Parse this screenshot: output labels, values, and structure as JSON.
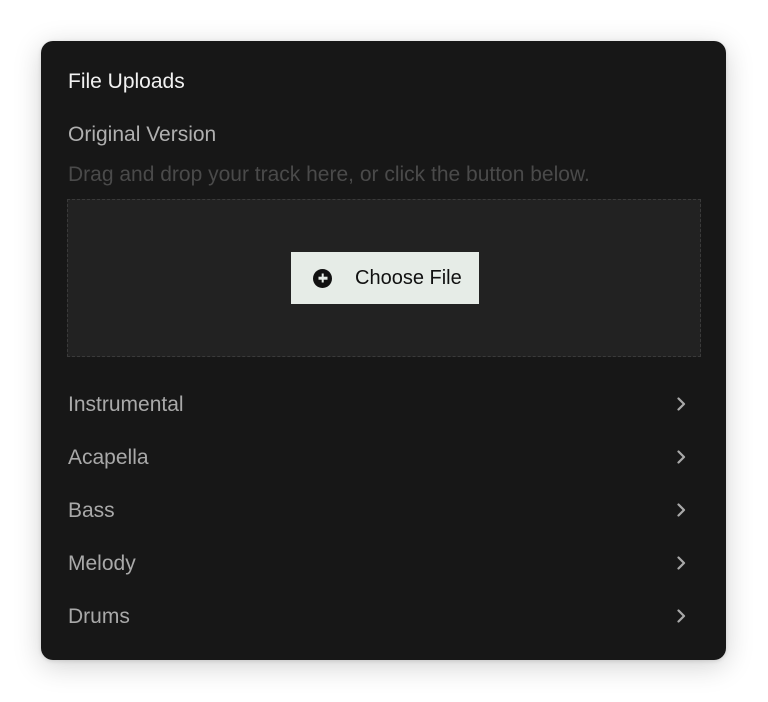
{
  "panel": {
    "title": "File Uploads",
    "original": {
      "label": "Original Version",
      "hint": "Drag and drop your track here, or click the button below.",
      "button_label": "Choose File",
      "button_icon": "plus-circle-icon"
    },
    "items": [
      {
        "label": "Instrumental",
        "icon": "chevron-right-icon"
      },
      {
        "label": "Acapella",
        "icon": "chevron-right-icon"
      },
      {
        "label": "Bass",
        "icon": "chevron-right-icon"
      },
      {
        "label": "Melody",
        "icon": "chevron-right-icon"
      },
      {
        "label": "Drums",
        "icon": "chevron-right-icon"
      }
    ]
  },
  "colors": {
    "card_background": "#171717",
    "dropzone_background": "#222222",
    "button_background": "#e6ece7",
    "title_text": "#f2f2f2",
    "muted_text": "#a9a9a9",
    "hint_text": "#4a4a4a"
  }
}
